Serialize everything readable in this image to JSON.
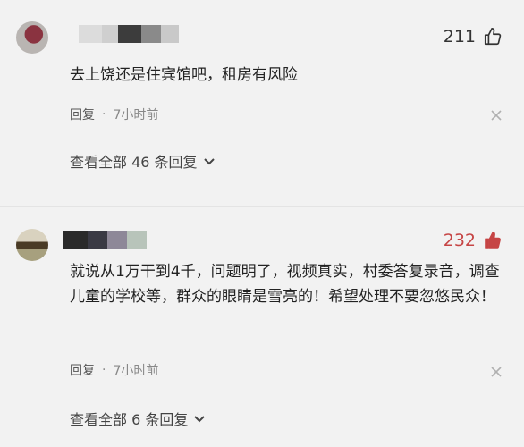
{
  "comments": [
    {
      "likes": "211",
      "text": "去上饶还是住宾馆吧，租房有风险",
      "reply_label": "回复",
      "separator": "·",
      "time": "7小时前",
      "view_replies": "查看全部 46 条回复",
      "liked": false
    },
    {
      "likes": "232",
      "text": "就说从1万干到4千，问题明了，视频真实，村委答复录音，调查儿童的学校等，群众的眼睛是雪亮的！希望处理不要忽悠民众！",
      "reply_label": "回复",
      "separator": "·",
      "time": "7小时前",
      "view_replies": "查看全部 6 条回复",
      "liked": true
    }
  ],
  "colors": {
    "background": "#f2f2f2",
    "liked_red": "#c64545",
    "text": "#222222",
    "meta": "#888888"
  },
  "icons": [
    "thumbs-up-icon",
    "close-icon",
    "chevron-down-icon"
  ]
}
